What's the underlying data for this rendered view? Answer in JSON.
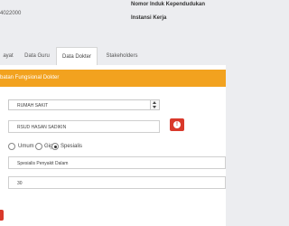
{
  "top": {
    "code_fragment": "4022000",
    "nik_label": "Nomor Induk Kependudukan",
    "institution_label": "Instansi Kerja"
  },
  "tabs": [
    {
      "label": "ayat"
    },
    {
      "label": "Data Guru"
    },
    {
      "label": "Data Dokter",
      "active": true
    },
    {
      "label": "Stakeholders"
    }
  ],
  "section": {
    "title": "batan Fungsional Dokter",
    "header_color": "#f2a21f"
  },
  "form": {
    "workplace_type": "RUMAH SAKIT",
    "hospital_name": "RSUD HASAN SADIKIN",
    "specialty_options": [
      "Umum",
      "Gigi",
      "Spesialis"
    ],
    "specialty_selected": "Spesialis",
    "specialty_value": "Spesialis Penyakit Dalam",
    "number_value": "30"
  },
  "icons": {
    "alert": "exclamation-circle-icon",
    "alert_color": "#d9392b"
  }
}
